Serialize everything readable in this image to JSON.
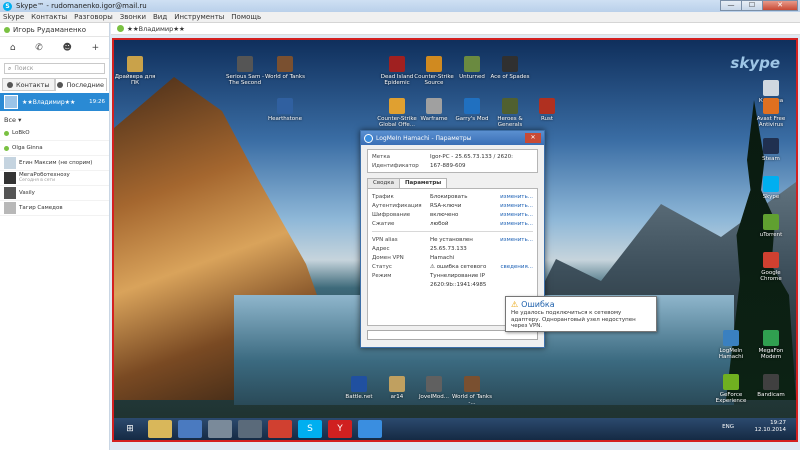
{
  "window": {
    "title": "Skype™ - rudomanenko.igor@mail.ru",
    "min": "—",
    "max": "☐",
    "close": "✕"
  },
  "menu": [
    "Skype",
    "Контакты",
    "Разговоры",
    "Звонки",
    "Вид",
    "Инструменты",
    "Помощь"
  ],
  "profile": {
    "name": "Игорь Рудаманенко"
  },
  "search": {
    "placeholder": "Поиск"
  },
  "tabs": {
    "contacts": "Контакты",
    "recent": "Последние"
  },
  "selected_contact": {
    "name": "★★Владимир★★",
    "time": "19:26"
  },
  "filter": {
    "label": "Все"
  },
  "contacts": [
    {
      "name": "LoBkO",
      "status": "online"
    },
    {
      "name": "Olga Ginna",
      "status": "online"
    },
    {
      "name": "Егин Максим (не спорим)",
      "status": "online"
    },
    {
      "name": "МегаРоботехнозу",
      "sub": "Сегодня в сети",
      "status": "online"
    },
    {
      "name": "Vasily",
      "status": "offline"
    },
    {
      "name": "Тагир Самедов",
      "status": "offline"
    }
  ],
  "share_header": {
    "name": "★★Владимир★★"
  },
  "desktop_icons": [
    {
      "label": "Драйвера для ПК",
      "color": "#c9a24a"
    },
    {
      "label": "Serious Sam - The Second",
      "color": "#555"
    },
    {
      "label": "World of Tanks",
      "color": "#7a5030"
    },
    {
      "label": "Dead Island Epidemic",
      "color": "#a02020"
    },
    {
      "label": "Counter-Strike Source",
      "color": "#d08a20"
    },
    {
      "label": "Unturned",
      "color": "#6a8a40"
    },
    {
      "label": "Ace of Spades",
      "color": "#303030"
    },
    {
      "label": "Hearthstone",
      "color": "#3060a0"
    },
    {
      "label": "Counter-Strike Global Offe...",
      "color": "#e0a030"
    },
    {
      "label": "Warframe",
      "color": "#a0a0a0"
    },
    {
      "label": "Garry's Mod",
      "color": "#2070c0"
    },
    {
      "label": "Heroes & Generals",
      "color": "#506030"
    },
    {
      "label": "Rust",
      "color": "#b03020"
    },
    {
      "label": "Корзина",
      "color": "#d0d8e0"
    },
    {
      "label": "Avast Free Antivirus",
      "color": "#e07020"
    },
    {
      "label": "Steam",
      "color": "#203050"
    },
    {
      "label": "Skype",
      "color": "#00aff0"
    },
    {
      "label": "uTorrent",
      "color": "#60a030"
    },
    {
      "label": "Google Chrome",
      "color": "#d04030"
    },
    {
      "label": "LogMeIn Hamachi",
      "color": "#3a80c0"
    },
    {
      "label": "MegaFon Modem",
      "color": "#30a050"
    },
    {
      "label": "GeForce Experience",
      "color": "#70b020"
    },
    {
      "label": "Bandicam",
      "color": "#404040"
    },
    {
      "label": "Battle.net",
      "color": "#2050a0"
    },
    {
      "label": "ar14",
      "color": "#c0a060"
    },
    {
      "label": "JoveIMod...",
      "color": "#606060"
    },
    {
      "label": "World of Tanks -...",
      "color": "#7a5030"
    }
  ],
  "desktop_logo": "skype",
  "dialog": {
    "title": "LogMeIn Hamachi - Параметры",
    "header": [
      {
        "k": "Метка",
        "v": "Igor-PC - 25.65.73.133 / 2620:",
        "l": "изменить..."
      },
      {
        "k": "Идентификатор",
        "v": "167-889-609",
        "l": ""
      }
    ],
    "tabs": [
      "Сводка",
      "Параметры"
    ],
    "rows1": [
      {
        "k": "Трафик",
        "v": "Блокировать",
        "l": "изменить..."
      },
      {
        "k": "Аутентификация",
        "v": "RSA-ключи",
        "l": "изменить..."
      },
      {
        "k": "Шифрование",
        "v": "включено",
        "l": "изменить..."
      },
      {
        "k": "Сжатие",
        "v": "любой",
        "l": "изменить..."
      }
    ],
    "rows2": [
      {
        "k": "VPN alias",
        "v": "Не установлен",
        "l": "изменить..."
      },
      {
        "k": "Адрес",
        "v": "25.65.73.133",
        "l": ""
      },
      {
        "k": "Домен VPN",
        "v": "Hamachi",
        "l": ""
      },
      {
        "k": "Статус",
        "v": "ошибка сетевого",
        "l": "сведения..."
      },
      {
        "k": "Режим",
        "v": "Туннелирование IP",
        "l": ""
      },
      {
        "k": "",
        "v": "2620:9b::1941:4985",
        "l": ""
      }
    ]
  },
  "tooltip": {
    "title": "Ошибка",
    "message": "Не удалось подключиться к сетевому адаптеру. Одноранговый узел недоступен через VPN."
  },
  "tray": {
    "lang": "ENG",
    "time": "19:27",
    "date": "12.10.2014"
  }
}
